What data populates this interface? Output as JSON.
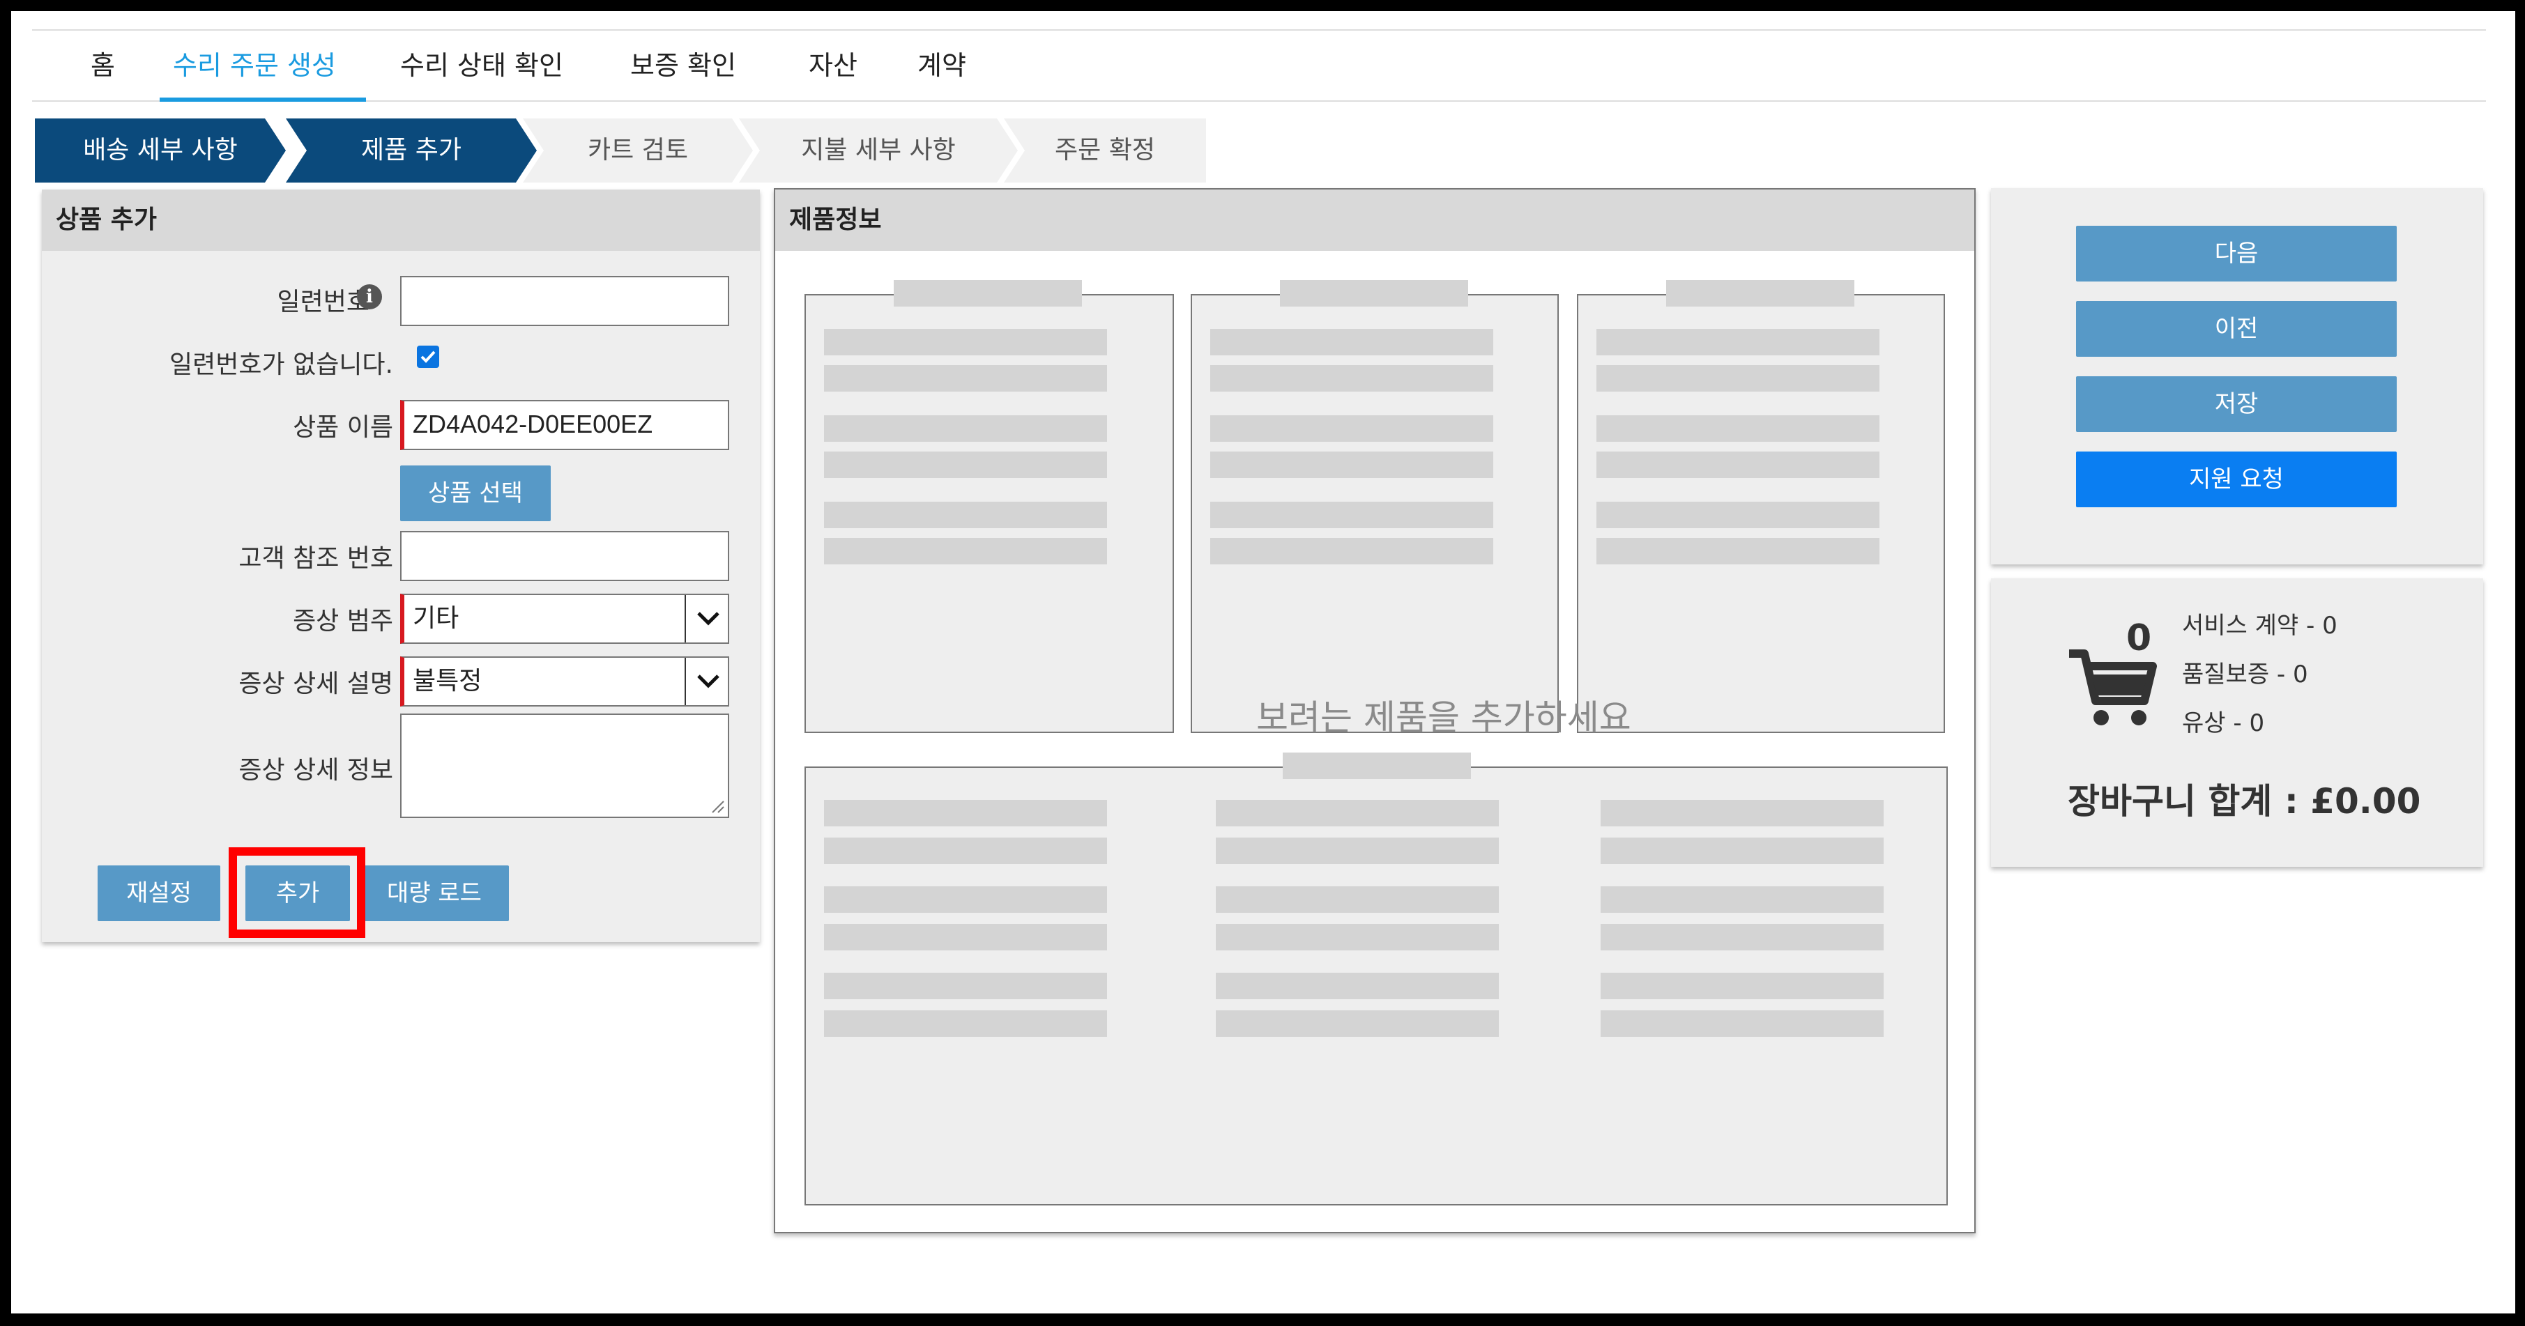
{
  "nav": {
    "items": [
      "홈",
      "수리 주문 생성",
      "수리 상태 확인",
      "보증 확인",
      "자산",
      "계약"
    ],
    "active_index": 1
  },
  "steps": [
    {
      "label": "배송 세부 사항",
      "state": "done"
    },
    {
      "label": "제품 추가",
      "state": "done"
    },
    {
      "label": "카트 검토",
      "state": "todo"
    },
    {
      "label": "지불 세부 사항",
      "state": "todo"
    },
    {
      "label": "주문 확정",
      "state": "todo"
    }
  ],
  "add_product": {
    "title": "상품 추가",
    "serial_label": "일련번호",
    "serial_value": "",
    "no_serial_label": "일련번호가 없습니다.",
    "no_serial_checked": true,
    "product_name_label": "상품 이름",
    "product_name_value": "ZD4A042-D0EE00EZ",
    "select_product_button": "상품 선택",
    "customer_ref_label": "고객 참조 번호",
    "customer_ref_value": "",
    "symptom_category_label": "증상 범주",
    "symptom_category_value": "기타",
    "symptom_detail_label": "증상 상세 설명",
    "symptom_detail_value": "불특정",
    "symptom_info_label": "증상 상세 정보",
    "symptom_info_value": "",
    "reset_button": "재설정",
    "add_button": "추가",
    "bulk_load_button": "대량 로드"
  },
  "product_info": {
    "title": "제품정보",
    "placeholder": "보려는 제품을 추가하세요"
  },
  "actions": {
    "next": "다음",
    "previous": "이전",
    "save": "저장",
    "support": "지원 요청"
  },
  "cart": {
    "icon": "shopping-cart-icon",
    "count": "0",
    "service_contract": "서비스 계약 - 0",
    "warranty": "품질보증 - 0",
    "paid": "유상 - 0",
    "total": "장바구니 합계 : £0.00"
  },
  "colors": {
    "accent": "#1a9be0",
    "step_done": "#0b4a7c",
    "button": "#5799c7",
    "primary_button": "#0a7ef2",
    "required": "#d71920",
    "highlight": "#ff0000"
  }
}
